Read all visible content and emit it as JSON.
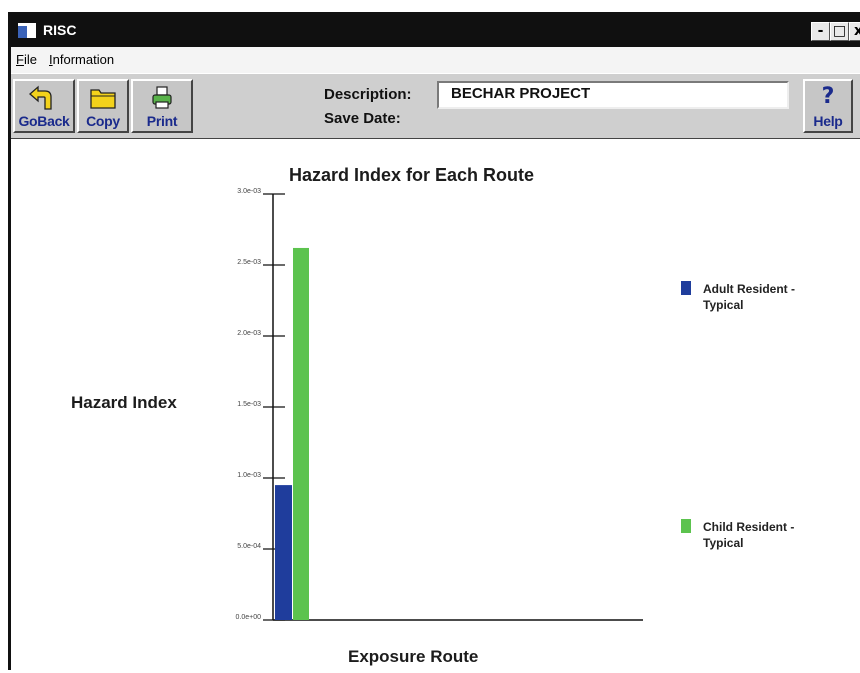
{
  "window": {
    "title": "RISC",
    "controls": {
      "minimize": "-",
      "maximize": "□",
      "close": "x"
    }
  },
  "menu": {
    "file": "File",
    "information": "Information"
  },
  "toolbar": {
    "goback_label": "GoBack",
    "copy_label": "Copy",
    "print_label": "Print",
    "help_label": "Help",
    "help_glyph": "?",
    "description_label": "Description:",
    "description_value": "BECHAR PROJECT",
    "save_date_label": "Save Date:"
  },
  "chart_data": {
    "type": "bar",
    "title": "Hazard Index for Each Route",
    "xlabel": "Exposure Route",
    "ylabel": "Hazard Index",
    "ylim": [
      0,
      0.003
    ],
    "yticks": [
      {
        "value": 0,
        "label": "0.0e+00"
      },
      {
        "value": 0.0005,
        "label": "5.0e-04"
      },
      {
        "value": 0.001,
        "label": "1.0e-03"
      },
      {
        "value": 0.0015,
        "label": "1.5e-03"
      },
      {
        "value": 0.002,
        "label": "2.0e-03"
      },
      {
        "value": 0.0025,
        "label": "2.5e-03"
      },
      {
        "value": 0.003,
        "label": "3.0e-03"
      }
    ],
    "categories": [
      ""
    ],
    "series": [
      {
        "name": "Adult Resident - Typical",
        "values": [
          0.00095
        ],
        "color": "#1f3d9c"
      },
      {
        "name": "Child Resident - Typical",
        "values": [
          0.00262
        ],
        "color": "#5cc34e"
      }
    ],
    "legend_position": "right",
    "grid": false
  }
}
